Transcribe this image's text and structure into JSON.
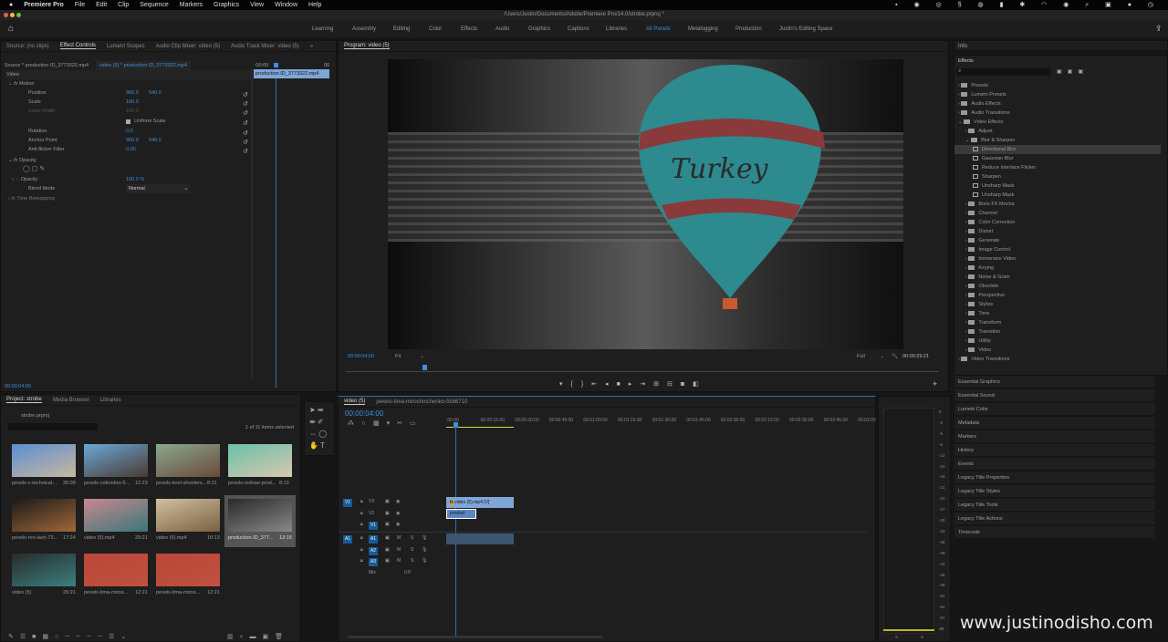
{
  "menubar": {
    "app": "Premiere Pro",
    "items": [
      "File",
      "Edit",
      "Clip",
      "Sequence",
      "Markers",
      "Graphics",
      "View",
      "Window",
      "Help"
    ]
  },
  "window": {
    "title": "/Users/Justin/Documents/Adobe/Premiere Pro/14.0/strobe.prproj *"
  },
  "workspaces": [
    "Learning",
    "Assembly",
    "Editing",
    "Color",
    "Effects",
    "Audio",
    "Graphics",
    "Captions",
    "Libraries",
    "All Panels",
    "Metalogging",
    "Production",
    "Justin's Editing Space"
  ],
  "active_workspace": "All Panels",
  "left_tabs": [
    "Source: (no clips)",
    "Effect Controls",
    "Lumetri Scopes",
    "Audio Clip Mixer: video (5)",
    "Audio Track Mixer: video (5)"
  ],
  "effect_controls": {
    "source": "Source * production ID_3773322.mp4",
    "sequence": "video (5) * production ID_3773322.mp4",
    "section": "Video",
    "ruler_start": ":00:00",
    "ruler_end": "00",
    "clip": "production ID_3773322.mp4",
    "motion": "Motion",
    "opacity_group": "Opacity",
    "time_remap": "Time Remapping",
    "props": [
      {
        "name": "Position",
        "v1": "960.0",
        "v2": "540.0"
      },
      {
        "name": "Scale",
        "v1": "100.0",
        "v2": ""
      },
      {
        "name": "Scale Width",
        "v1": "100.0",
        "v2": ""
      },
      {
        "name": "",
        "v1": "Uniform Scale",
        "v2": ""
      },
      {
        "name": "Rotation",
        "v1": "0.0",
        "v2": ""
      },
      {
        "name": "Anchor Point",
        "v1": "960.0",
        "v2": "540.0"
      },
      {
        "name": "Anti-flicker Filter",
        "v1": "0.00",
        "v2": ""
      }
    ],
    "opacity": {
      "name": "Opacity",
      "value": "100.0 %"
    },
    "blend": {
      "name": "Blend Mode",
      "value": "Normal"
    },
    "timecode": "00:00:04:00"
  },
  "program": {
    "title": "Program: video (5)",
    "timecode": "00:00:04:00",
    "fit": "Fit",
    "quality": "Full",
    "duration": "00:00:29:21",
    "balloon_text": "Turkey"
  },
  "info_title": "Info",
  "effects": {
    "title": "Effects",
    "tree": [
      {
        "l": 0,
        "t": "folder",
        "label": "Presets"
      },
      {
        "l": 0,
        "t": "folder",
        "label": "Lumetri Presets"
      },
      {
        "l": 0,
        "t": "folder",
        "label": "Audio Effects"
      },
      {
        "l": 0,
        "t": "folder",
        "label": "Audio Transitions"
      },
      {
        "l": 0,
        "t": "folder",
        "label": "Video Effects",
        "open": true
      },
      {
        "l": 1,
        "t": "folder",
        "label": "Adjust"
      },
      {
        "l": 1,
        "t": "folder",
        "label": "Blur & Sharpen",
        "open": true
      },
      {
        "l": 2,
        "t": "fx",
        "label": "Directional Blur",
        "sel": true
      },
      {
        "l": 2,
        "t": "fx",
        "label": "Gaussian Blur"
      },
      {
        "l": 2,
        "t": "fx",
        "label": "Reduce Interlace Flicker"
      },
      {
        "l": 2,
        "t": "fx",
        "label": "Sharpen"
      },
      {
        "l": 2,
        "t": "fx",
        "label": "Unsharp Mask"
      },
      {
        "l": 2,
        "t": "fx",
        "label": "Unsharp Mask"
      },
      {
        "l": 1,
        "t": "folder",
        "label": "Boris FX Mocha"
      },
      {
        "l": 1,
        "t": "folder",
        "label": "Channel"
      },
      {
        "l": 1,
        "t": "folder",
        "label": "Color Correction"
      },
      {
        "l": 1,
        "t": "folder",
        "label": "Distort"
      },
      {
        "l": 1,
        "t": "folder",
        "label": "Generate"
      },
      {
        "l": 1,
        "t": "folder",
        "label": "Image Control"
      },
      {
        "l": 1,
        "t": "folder",
        "label": "Immersive Video"
      },
      {
        "l": 1,
        "t": "folder",
        "label": "Keying"
      },
      {
        "l": 1,
        "t": "folder",
        "label": "Noise & Grain"
      },
      {
        "l": 1,
        "t": "folder",
        "label": "Obsolete"
      },
      {
        "l": 1,
        "t": "folder",
        "label": "Perspective"
      },
      {
        "l": 1,
        "t": "folder",
        "label": "Stylize"
      },
      {
        "l": 1,
        "t": "folder",
        "label": "Time"
      },
      {
        "l": 1,
        "t": "folder",
        "label": "Transform"
      },
      {
        "l": 1,
        "t": "folder",
        "label": "Transition"
      },
      {
        "l": 1,
        "t": "folder",
        "label": "Utility"
      },
      {
        "l": 1,
        "t": "folder",
        "label": "Video"
      },
      {
        "l": 0,
        "t": "folder",
        "label": "Video Transitions"
      }
    ]
  },
  "panels": [
    "Essential Graphics",
    "Essential Sound",
    "Lumetri Color",
    "Metadata",
    "Markers",
    "History",
    "Events",
    "Legacy Title Properties",
    "Legacy Title Styles",
    "Legacy Title Tools",
    "Legacy Title Actions",
    "Timecode"
  ],
  "project": {
    "tabs": [
      "Project: strobe",
      "Media Browser",
      "Libraries"
    ],
    "file": "strobe.prproj",
    "selected": "1 of 11 items selected",
    "items": [
      {
        "name": "pexels-c-technical-...",
        "dur": "26:09",
        "c1": "#5a8ed0",
        "c2": "#c9b8a0"
      },
      {
        "name": "pexels-cottonbro-5...",
        "dur": "12:23",
        "c1": "#6aa8d8",
        "c2": "#4a3a30"
      },
      {
        "name": "pexels-kool-shooters...",
        "dur": "8:21",
        "c1": "#8aa890",
        "c2": "#6a4a38"
      },
      {
        "name": "pexels-rodnae-prod...",
        "dur": "8:13",
        "c1": "#6ac0a8",
        "c2": "#d8c8b0"
      },
      {
        "name": "pexels-ron-lach-73...",
        "dur": "17:24",
        "c1": "#1a1a1a",
        "c2": "#a06838"
      },
      {
        "name": "video (5).mp4",
        "dur": "29:21",
        "c1": "#c88890",
        "c2": "#3a7878"
      },
      {
        "name": "video (6).mp4",
        "dur": "10:13",
        "c1": "#d0c0a0",
        "c2": "#7a6040"
      },
      {
        "name": "production ID_377...",
        "dur": "13:15",
        "c1": "#2a2a2a",
        "c2": "#888",
        "sel": true
      },
      {
        "name": "video (5)",
        "dur": "29:21",
        "c1": "#2a2a2a",
        "c2": "#3a8080"
      },
      {
        "name": "pexels-tima-miros...",
        "dur": "12:21",
        "c1": "#b84838",
        "c2": "#c05040"
      },
      {
        "name": "pexels-tima-miros...",
        "dur": "12:21",
        "c1": "#b84838",
        "c2": "#c05040"
      }
    ]
  },
  "timeline": {
    "tab": "video (5)",
    "tab2": "pexels-tima-miroshnichenko-5586710",
    "timecode": "00:00:04:00",
    "ruler": [
      ":00:00",
      "00:00:15:00",
      "00:00:30:00",
      "00:00:45:00",
      "00:01:00:00",
      "00:01:15:00",
      "00:01:30:00",
      "00:01:45:00",
      "00:02:00:00",
      "00:02:15:00",
      "00:02:30:00",
      "00:02:45:00",
      "00:03:00"
    ],
    "vtracks": [
      "V3",
      "V2",
      "V1"
    ],
    "atracks": [
      "A1",
      "A2",
      "A3"
    ],
    "src_v": "V1",
    "src_a": "A1",
    "mix": "Mix",
    "mix_val": "0.0",
    "clip1": "video (5).mp4 [V]",
    "clip2": "product",
    "m": "M",
    "s": "S"
  },
  "meter": {
    "scale": [
      "0",
      "-3",
      "-6",
      "-9",
      "-12",
      "-15",
      "-18",
      "-21",
      "-24",
      "-27",
      "-30",
      "-33",
      "-36",
      "-39",
      "-42",
      "-45",
      "-48",
      "-51",
      "-54",
      "-57",
      "dB"
    ],
    "solo": [
      "S",
      "S"
    ]
  },
  "watermark": "www.justinodisho.com"
}
